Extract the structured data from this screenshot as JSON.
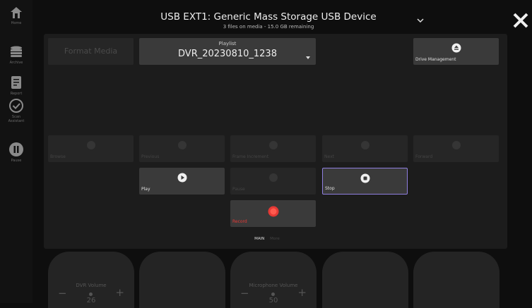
{
  "sidebar": {
    "items": [
      {
        "label": "Home",
        "icon": "home-icon"
      },
      {
        "label": "Archive",
        "icon": "archive-icon"
      },
      {
        "label": "Report",
        "icon": "report-icon"
      },
      {
        "label": "Scan Assistant",
        "icon": "check-circle-icon"
      },
      {
        "label": "Pause",
        "icon": "pause-icon"
      }
    ]
  },
  "header": {
    "title": "USB EXT1: Generic Mass Storage USB Device",
    "subtitle": "3 files on media - 15.0 GB remaining"
  },
  "format_button": {
    "label": "Format Media"
  },
  "playlist": {
    "label": "Playlist",
    "value": "DVR_20230810_1238"
  },
  "drive_management": {
    "label": "Drive Management",
    "icon": "eject-icon"
  },
  "transport": {
    "browse": {
      "label": "Browse",
      "icon": "browse-icon",
      "enabled": false
    },
    "previous": {
      "label": "Previous",
      "icon": "previous-icon",
      "enabled": false
    },
    "frame_increment": {
      "label": "Frame Increment",
      "icon": "frame-increment-icon",
      "enabled": false
    },
    "next": {
      "label": "Next",
      "icon": "next-icon",
      "enabled": false
    },
    "forward": {
      "label": "Forward",
      "icon": "forward-icon",
      "enabled": false
    },
    "play": {
      "label": "Play",
      "icon": "play-icon",
      "enabled": true
    },
    "pause": {
      "label": "Pause",
      "icon": "pause-icon",
      "enabled": false
    },
    "stop": {
      "label": "Stop",
      "icon": "stop-icon",
      "enabled": true
    },
    "record": {
      "label": "Record",
      "icon": "record-icon",
      "enabled": true
    }
  },
  "tabs": [
    {
      "label": "MAIN",
      "active": true
    },
    {
      "label": "More",
      "active": false
    }
  ],
  "knobs": [
    {
      "label": "DVR Volume",
      "value": "26"
    },
    {
      "label": "",
      "value": ""
    },
    {
      "label": "Microphone Volume",
      "value": "50"
    },
    {
      "label": "",
      "value": ""
    },
    {
      "label": "",
      "value": ""
    }
  ],
  "colors": {
    "accent_purple": "#8f7fe0",
    "record_red": "#e53935",
    "record_label": "#e53935"
  }
}
